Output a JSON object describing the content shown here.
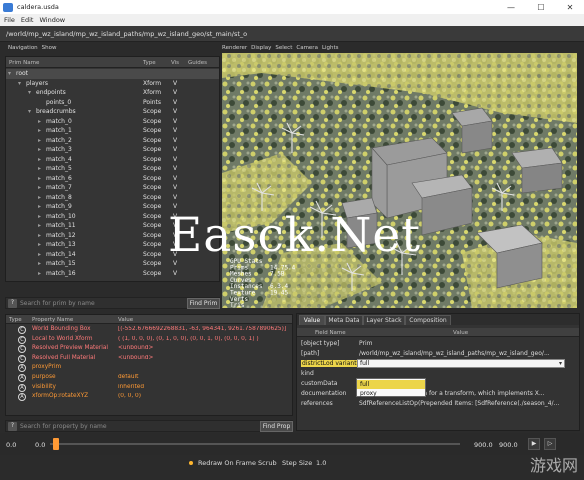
{
  "window": {
    "title": "caldera.usda"
  },
  "menu": [
    "File",
    "Edit",
    "Window"
  ],
  "path": "/world/mp_wz_island/mp_wz_island_paths/mp_wz_island_geo/st_main/st_o",
  "left_panel": {
    "nav_label": "Navigation",
    "show_label": "Show"
  },
  "tree": {
    "columns": {
      "name": "Prim Name",
      "type": "Type",
      "vis": "Vis",
      "guides": "Guides"
    },
    "rows": [
      {
        "name": "root",
        "type": "",
        "vis": ""
      },
      {
        "name": "players",
        "type": "Xform",
        "vis": "V"
      },
      {
        "name": "endpoints",
        "type": "Xform",
        "vis": "V"
      },
      {
        "name": "points_0",
        "type": "Points",
        "vis": "V"
      },
      {
        "name": "breadcrumbs",
        "type": "Scope",
        "vis": "V"
      },
      {
        "name": "match_0",
        "type": "Scope",
        "vis": "V"
      },
      {
        "name": "match_1",
        "type": "Scope",
        "vis": "V"
      },
      {
        "name": "match_2",
        "type": "Scope",
        "vis": "V"
      },
      {
        "name": "match_3",
        "type": "Scope",
        "vis": "V"
      },
      {
        "name": "match_4",
        "type": "Scope",
        "vis": "V"
      },
      {
        "name": "match_5",
        "type": "Scope",
        "vis": "V"
      },
      {
        "name": "match_6",
        "type": "Scope",
        "vis": "V"
      },
      {
        "name": "match_7",
        "type": "Scope",
        "vis": "V"
      },
      {
        "name": "match_8",
        "type": "Scope",
        "vis": "V"
      },
      {
        "name": "match_9",
        "type": "Scope",
        "vis": "V"
      },
      {
        "name": "match_10",
        "type": "Scope",
        "vis": "V"
      },
      {
        "name": "match_11",
        "type": "Scope",
        "vis": "V"
      },
      {
        "name": "match_12",
        "type": "Scope",
        "vis": "V"
      },
      {
        "name": "match_13",
        "type": "Scope",
        "vis": "V"
      },
      {
        "name": "match_14",
        "type": "Scope",
        "vis": "V"
      },
      {
        "name": "match_15",
        "type": "Scope",
        "vis": "V"
      },
      {
        "name": "match_16",
        "type": "Scope",
        "vis": "V"
      }
    ]
  },
  "prim_search": {
    "placeholder": "Search for prim by name",
    "button": "Find Prim"
  },
  "viewport_menu": [
    "Renderer",
    "Display",
    "Select",
    "Camera",
    "Lights"
  ],
  "hud": {
    "lines": [
      "GPU Stats",
      "Prims",
      "Meshes",
      "Curves",
      "Instances",
      "Texture",
      "Verts",
      "Tris"
    ],
    "values": [
      "",
      "14.75.4",
      "7.5B",
      "",
      "6.3.4",
      "19.45",
      "",
      ""
    ]
  },
  "properties": {
    "columns": {
      "type": "Type",
      "name": "Property Name",
      "value": "Value"
    },
    "rows": [
      {
        "icon": "C",
        "name": "World Bounding Box",
        "value": "[(-552.6766692268831, -63, 964341, 9261.7587890625)]",
        "color": "#ff7a7a"
      },
      {
        "icon": "C",
        "name": "Local to World Xform",
        "value": "( (1, 0, 0, 0), (0, 1, 0, 0), (0, 0, 1, 0), (0, 0, 0, 1) )",
        "color": "#ff7a7a"
      },
      {
        "icon": "C",
        "name": "Resolved Preview Material",
        "value": "<unbound>",
        "color": "#ff7a7a"
      },
      {
        "icon": "C",
        "name": "Resolved Full Material",
        "value": "<unbound>",
        "color": "#ff7a7a"
      },
      {
        "icon": "A",
        "name": "proxyPrim",
        "value": "",
        "color": "#ff9a35"
      },
      {
        "icon": "A",
        "name": "purpose",
        "value": "default",
        "color": "#ff9a35"
      },
      {
        "icon": "A",
        "name": "visibility",
        "value": "inherited",
        "color": "#ff9a35"
      },
      {
        "icon": "A",
        "name": "xformOp:rotateXYZ",
        "value": "(0, 0, 0)",
        "color": "#ff9a35"
      }
    ]
  },
  "prop_search": {
    "placeholder": "Search for property by name",
    "button": "Find Prop"
  },
  "detail": {
    "tabs": [
      "Value",
      "Meta Data",
      "Layer Stack",
      "Composition"
    ],
    "columns": {
      "field": "Field Name",
      "value": "Value"
    },
    "rows": [
      {
        "key": "[object type]",
        "value": "Prim"
      },
      {
        "key": "[path]",
        "value": "/world/mp_wz_island/mp_wz_island_paths/mp_wz_island_geo/..."
      },
      {
        "key": "districtLod variant",
        "value": "full"
      },
      {
        "key": "kind",
        "value": ""
      },
      {
        "key": "customData",
        "value": ""
      },
      {
        "key": "documentation",
        "value": "Concrete prim schema for a transform, which implements X..."
      },
      {
        "key": "references",
        "value": "SdfReferenceListOp(Prepended Items: [SdfReference(./season_4/..."
      }
    ],
    "dropdown_options": [
      "full",
      "proxy"
    ]
  },
  "timeline": {
    "start": "0.0",
    "current": "0.0",
    "end": "900.0",
    "end2": "900.0"
  },
  "status": {
    "redraw": "Redraw On Frame Scrub",
    "step_label": "Step Size",
    "step_value": "1.0"
  },
  "watermark": {
    "main": "Easck.Net",
    "logo": "游戏网"
  }
}
